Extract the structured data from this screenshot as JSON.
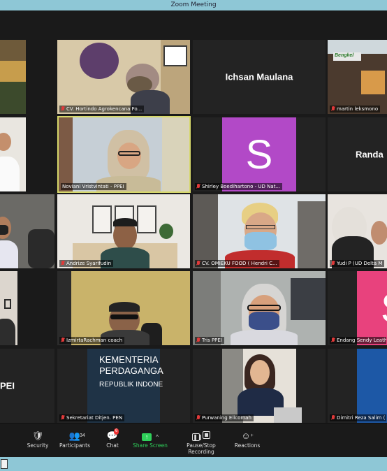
{
  "window": {
    "title": "Zoom Meeting"
  },
  "participants": [
    {
      "id": "t1",
      "name": "CV. Hortindo Agrokencana Fo..."
    },
    {
      "id": "t2",
      "name": "Ichsan Maulana"
    },
    {
      "id": "t3",
      "name": "martin leksmono"
    },
    {
      "id": "t4",
      "name": "Noviani Vristvintati - PPEI"
    },
    {
      "id": "t5",
      "name": "Shirley Boedihartono - UD Nat...",
      "initial": "S"
    },
    {
      "id": "t6",
      "name": "Randa"
    },
    {
      "id": "t7",
      "name": "Andrize Syarifudin"
    },
    {
      "id": "t8",
      "name": "CV. OMIEKU FOOD ( Hendri C..."
    },
    {
      "id": "t9",
      "name": "Yudi P (UD Delta M"
    },
    {
      "id": "t10",
      "name": "IzmirtaRachman coach"
    },
    {
      "id": "t11",
      "name": "Tris PPEI"
    },
    {
      "id": "t12",
      "name": "Endang Sendy Leath",
      "initial": "S"
    },
    {
      "id": "t13",
      "name": "PEI"
    },
    {
      "id": "t14",
      "name": "Sekretariat Ditjen. PEN",
      "slide_line1": "KEMENTERIA",
      "slide_line2": "PERDAGANGA",
      "slide_line3": "REPUBLIK INDONE"
    },
    {
      "id": "t15",
      "name": "Purwaning  Ellcomah"
    },
    {
      "id": "t16",
      "name": "Dimitri Reza Salim ("
    }
  ],
  "toolbar": {
    "security": "Security",
    "participants": "Participants",
    "participants_count": "34",
    "chat": "Chat",
    "chat_badge": "6",
    "share": "Share Screen",
    "record": "Pause/Stop Recording",
    "reactions": "Reactions"
  },
  "colors": {
    "avatar_purple": "#b249c7",
    "avatar_pink": "#e8427d",
    "active_speaker": "#d6d86a",
    "share_green": "#2fd05a"
  }
}
